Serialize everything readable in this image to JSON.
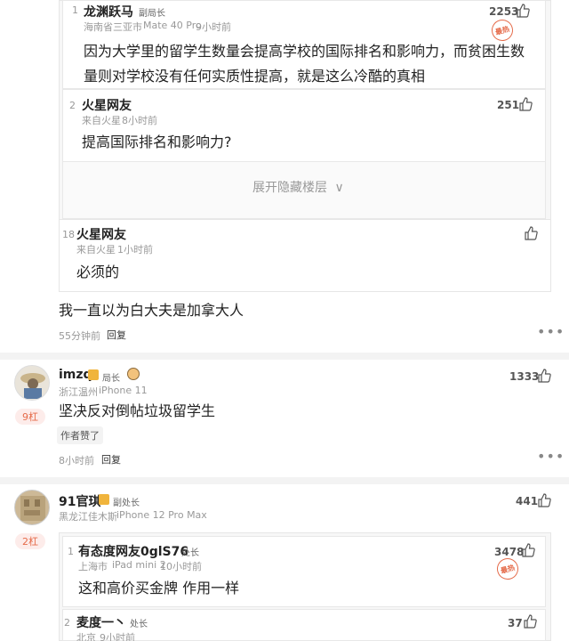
{
  "thread1": {
    "reply1": {
      "floor": "1",
      "username": "龙渊跃马",
      "title": "副局长",
      "location_device": "海南省三亚市",
      "device": "Mate 40 Pro",
      "time": "9小时前",
      "likes": "2253",
      "hot_label": "最热",
      "content_line1": "因为大学里的留学生数量会提高学校的国际排名和影响力，而贫困生数",
      "content_line2": "量则对学校没有任何实质性提高，就是这么冷酷的真相"
    },
    "reply2": {
      "floor": "2",
      "username": "火星网友",
      "location": "来自火星",
      "time": "8小时前",
      "likes": "251",
      "content": "提高国际排名和影响力?"
    },
    "expand_label": "展开隐藏楼层",
    "reply18": {
      "floor": "18",
      "username": "火星网友",
      "location": "来自火星",
      "time": "1小时前",
      "content": "必须的"
    },
    "main_content": "我一直以为白大夫是加拿大人",
    "main_time": "55分钟前",
    "reply_label": "回复"
  },
  "comment2": {
    "username": "imzq",
    "title": "局长",
    "location": "浙江温州",
    "device": "iPhone 11",
    "likes": "1333",
    "rank_badge": "9杠",
    "content": "坚决反对倒帖垃圾留学生",
    "author_liked": "作者赞了",
    "time": "8小时前",
    "reply_label": "回复"
  },
  "comment3": {
    "username": "91官琪",
    "title": "副处长",
    "location": "黑龙江佳木斯",
    "device": "iPhone 12 Pro Max",
    "likes": "441",
    "rank_badge": "2杠",
    "reply1": {
      "floor": "1",
      "username": "有态度网友0glS76",
      "title": "处长",
      "location": "上海市",
      "device": "iPad mini 2",
      "time": "10小时前",
      "likes": "3478",
      "hot_label": "最热",
      "content": "这和高价买金牌 作用一样"
    },
    "reply2": {
      "floor": "2",
      "username": "麦度一丶",
      "title": "处长",
      "location": "北京",
      "time": "9小时前",
      "likes": "37"
    }
  },
  "colors": {
    "accent_red": "#e56b4a",
    "badge_gold": "#f0b43c",
    "nested_bg": "#f7f7f7"
  }
}
